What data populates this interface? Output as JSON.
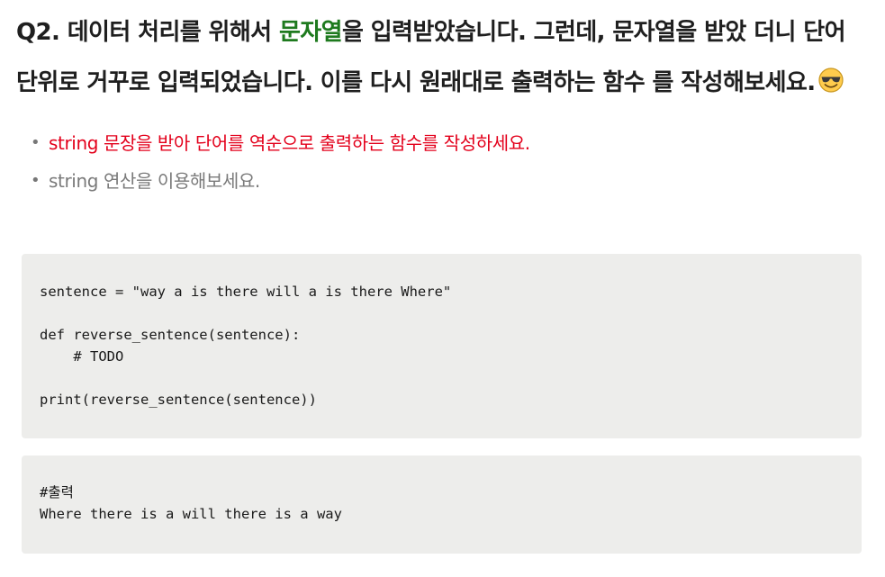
{
  "question": {
    "prefix": "Q2. 데이터 처리를 위해서 ",
    "highlight": "문자열",
    "suffix": "을 입력받았습니다. 그런데, 문자열을 받았 더니 단어 단위로 거꾸로 입력되었습니다. 이를 다시 원래대로 출력하는 함수 를 작성해보세요.",
    "emoji_icon": "sunglasses-face-emoji"
  },
  "bullets": [
    {
      "text": "string 문장을 받아 단어를 역순으로 출력하는 함수를 작성하세요.",
      "color": "#e3001b"
    },
    {
      "text": "string 연산을 이용해보세요.",
      "color": "#7a7a7a"
    }
  ],
  "code_block": {
    "lines": [
      "sentence = \"way a is there will a is there Where\"",
      "",
      "def reverse_sentence(sentence):",
      "    # TODO",
      "",
      "print(reverse_sentence(sentence))"
    ]
  },
  "output_block": {
    "lines": [
      "#출력",
      "Where there is a will there is a way"
    ]
  },
  "colors": {
    "highlight": "#1e7a1e",
    "requirement": "#e3001b",
    "hint": "#7a7a7a",
    "code_background": "#ededeb"
  }
}
